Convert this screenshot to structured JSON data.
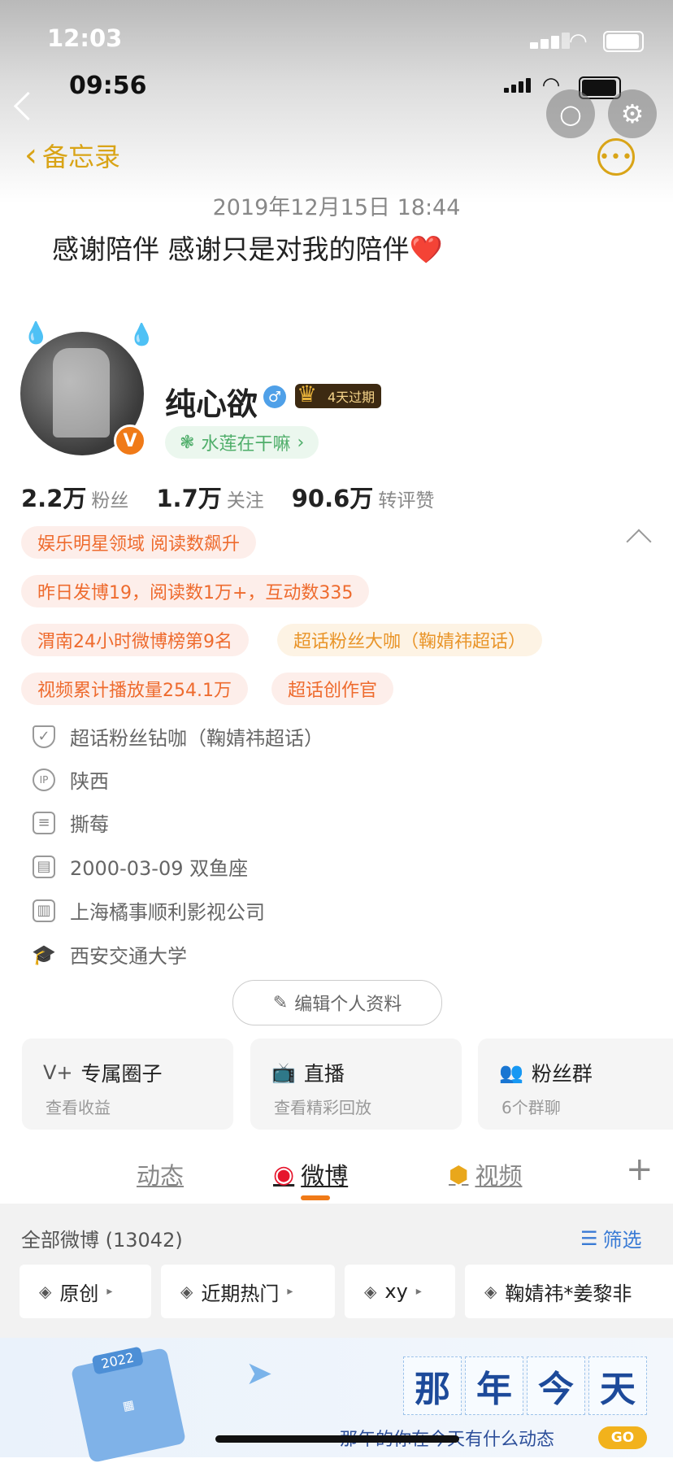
{
  "status_bar_outer": {
    "time": "12:03"
  },
  "status_bar_inner": {
    "time": "09:56"
  },
  "memo": {
    "title": "备忘录",
    "date": "2019年12月15日 18:44",
    "text": "感谢陪伴 感谢只是对我的陪伴",
    "heart": "❤️"
  },
  "profile": {
    "name": "纯心欲",
    "vip_badge": "4天过期",
    "status": "水莲在干嘛",
    "verified_letter": "V",
    "stats": [
      {
        "num": "2.2万",
        "label": "粉丝"
      },
      {
        "num": "1.7万",
        "label": "关注"
      },
      {
        "num": "90.6万",
        "label": "转评赞"
      }
    ],
    "tags": [
      "娱乐明星领域 阅读数飙升",
      "昨日发博19，阅读数1万+，互动数335",
      "渭南24小时微博榜第9名",
      "超话粉丝大咖（鞠婧祎超话）",
      "视频累计播放量254.1万",
      "超话创作官"
    ],
    "info": [
      {
        "icon": "shield-icon",
        "text": "超话粉丝钻咖（鞠婧祎超话）"
      },
      {
        "icon": "ip-icon",
        "text": "陕西"
      },
      {
        "icon": "document-icon",
        "text": "撕莓"
      },
      {
        "icon": "calendar-icon",
        "text": "2000-03-09 双鱼座"
      },
      {
        "icon": "building-icon",
        "text": "上海橘事顺利影视公司"
      },
      {
        "icon": "graduation-cap-icon",
        "text": "西安交通大学"
      }
    ],
    "ip_glyph": "IP",
    "edit_label": "编辑个人资料"
  },
  "cards": [
    {
      "title": "专属圈子",
      "sub": "查看收益"
    },
    {
      "title": "直播",
      "sub": "查看精彩回放"
    },
    {
      "title": "粉丝群",
      "sub": "6个群聊"
    }
  ],
  "tabs": [
    {
      "label": "动态"
    },
    {
      "label": "微博"
    },
    {
      "label": "视频"
    }
  ],
  "tab_plus": "+",
  "feed": {
    "count_label": "全部微博 (13042)",
    "filter_label": "筛选",
    "chips": [
      "原创",
      "近期热门",
      "xy",
      "鞠婧祎*姜黎非"
    ]
  },
  "banner": {
    "year": "2022",
    "chars": [
      "那",
      "年",
      "今",
      "天"
    ],
    "sub": "那年的你在今天有什么动态",
    "go": "GO"
  }
}
